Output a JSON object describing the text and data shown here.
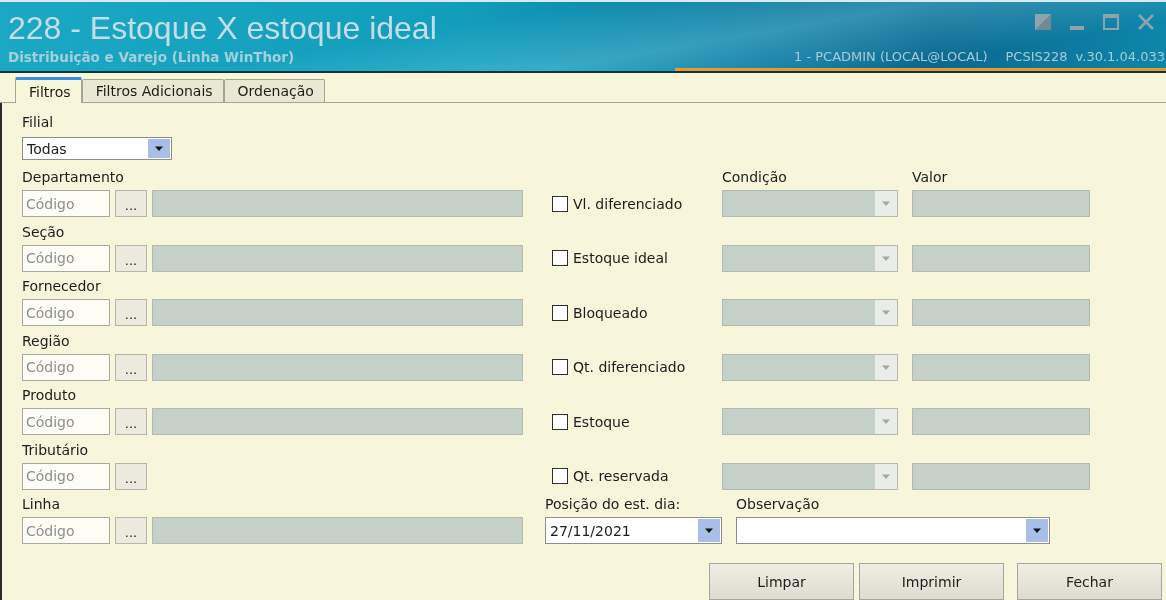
{
  "window": {
    "title": "228 - Estoque X estoque ideal",
    "subtitle": "Distribuição e Varejo (Linha WinThor)",
    "user": "1 - PCADMIN (LOCAL@LOCAL)",
    "module": "PCSIS228",
    "version": "v.30.1.04.033"
  },
  "tabs": [
    {
      "label": "Filtros",
      "selected": true
    },
    {
      "label": "Filtros Adicionais",
      "selected": false
    },
    {
      "label": "Ordenação",
      "selected": false
    }
  ],
  "branch": {
    "label": "Filial",
    "value": "Todas"
  },
  "filters": [
    {
      "label": "Departamento",
      "code": {
        "placeholder": "Código"
      },
      "lookup": "...",
      "description": {
        "disabled": true
      }
    },
    {
      "label": "Seção",
      "code": {
        "placeholder": "Código"
      },
      "lookup": "...",
      "description": {
        "disabled": true
      }
    },
    {
      "label": "Fornecedor",
      "code": {
        "placeholder": "Código"
      },
      "lookup": "...",
      "description": {
        "disabled": true
      }
    },
    {
      "label": "Região",
      "code": {
        "placeholder": "Código"
      },
      "lookup": "...",
      "description": {
        "disabled": true
      }
    },
    {
      "label": "Produto",
      "code": {
        "placeholder": "Código"
      },
      "lookup": "...",
      "description": {
        "disabled": true
      }
    },
    {
      "label": "Tributário",
      "code": {
        "placeholder": "Código"
      },
      "lookup": "..."
    },
    {
      "label": "Linha",
      "code": {
        "placeholder": "Código"
      },
      "lookup": "...",
      "description": {
        "disabled": true
      }
    }
  ],
  "columns": [
    "Condição",
    "Valor"
  ],
  "conditions": [
    {
      "label": "Vl. diferenciado",
      "checked": false,
      "condition": {
        "disabled": true
      },
      "value": {
        "disabled": true
      }
    },
    {
      "label": "Estoque ideal",
      "checked": false,
      "condition": {
        "disabled": true
      },
      "value": {
        "disabled": true
      }
    },
    {
      "label": "Bloqueado",
      "checked": false,
      "condition": {
        "disabled": true
      },
      "value": {
        "disabled": true
      }
    },
    {
      "label": "Qt. diferenciado",
      "checked": false,
      "condition": {
        "disabled": true
      },
      "value": {
        "disabled": true
      }
    },
    {
      "label": "Estoque",
      "checked": false,
      "condition": {
        "disabled": true
      },
      "value": {
        "disabled": true
      }
    },
    {
      "label": "Qt. reservada",
      "checked": false,
      "condition": {
        "disabled": true
      },
      "value": {
        "disabled": true
      }
    }
  ],
  "stock_date": {
    "label": "Posição do est. dia:",
    "value": "27/11/2021"
  },
  "observation": {
    "label": "Observação"
  },
  "buttons": [
    {
      "label": "Limpar"
    },
    {
      "label": "Imprimir"
    },
    {
      "label": "Fechar"
    }
  ]
}
